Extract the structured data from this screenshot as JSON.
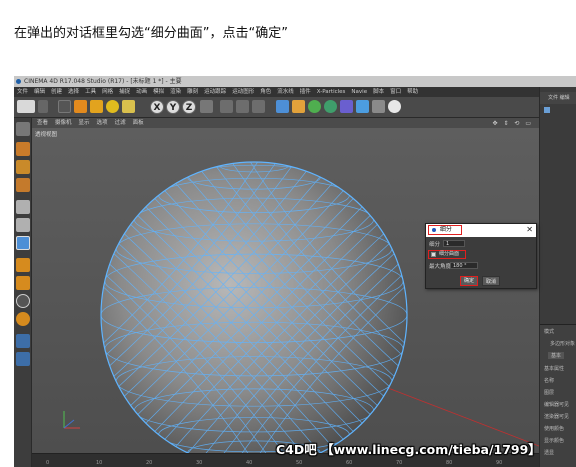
{
  "instruction": "在弹出的对话框里勾选“细分曲面”，点击“确定”",
  "app": {
    "title": "CINEMA 4D R17.048 Studio (R17) - [未标题 1 *] - 主要",
    "menu": [
      "文件",
      "编辑",
      "创建",
      "选择",
      "工具",
      "网格",
      "捕捉",
      "动画",
      "模拟",
      "渲染",
      "雕刻",
      "运动跟踪",
      "运动图形",
      "角色",
      "流水线",
      "插件",
      "X-Particles",
      "Navie",
      "脚本",
      "窗口",
      "帮助"
    ]
  },
  "toolbar": {
    "axis_buttons": [
      "X",
      "Y",
      "Z"
    ]
  },
  "viewport": {
    "menu": [
      "查看",
      "摄像机",
      "显示",
      "选项",
      "过滤",
      "面板"
    ],
    "label": "透视视图"
  },
  "right_panel": {
    "top_tabs": [
      "文件",
      "编辑"
    ],
    "lower_tab": "模式",
    "lower_title": "多边形对象",
    "lower_section": "基本",
    "rows": [
      "基本属性",
      "名称",
      "图层",
      "编辑器可见",
      "渲染器可见",
      "使用颜色",
      "显示颜色",
      "透显"
    ]
  },
  "timeline": {
    "ticks": [
      "0",
      "10",
      "20",
      "30",
      "40",
      "50",
      "60",
      "70",
      "80",
      "90"
    ]
  },
  "dialog": {
    "title": "细分",
    "close_glyph": "✕",
    "subdivide_label": "细分",
    "subdivide_value": "1",
    "subdivision_surface_label": "细分曲面",
    "subdivision_surface_checked": true,
    "max_angle_label": "最大角度",
    "max_angle_value": "180 °",
    "ok_label": "确定",
    "cancel_label": "取消"
  },
  "watermark": "C4D吧 【www.linecg.com/tieba/1799】",
  "colors": {
    "highlight": "#e0201f",
    "mesh_wire": "#5fb4ff",
    "sphere_core": "#a0a0a0"
  }
}
